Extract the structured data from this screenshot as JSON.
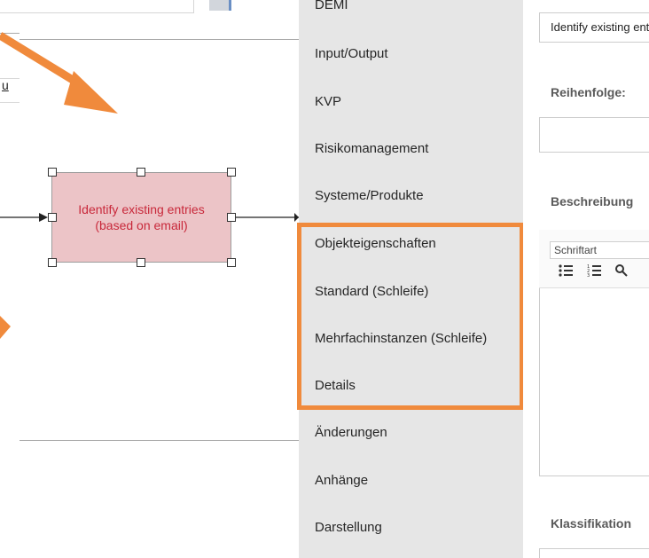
{
  "colors": {
    "accent_orange": "#f08a3c",
    "task_fill": "#ecc4c7",
    "task_text": "#c8283a",
    "menu_bg": "#e6e6e6"
  },
  "canvas": {
    "small_field_text": "u",
    "task": {
      "label_line1": "Identify existing entries",
      "label_line2": "(based on email)"
    }
  },
  "menu": {
    "items": [
      "DEMI",
      "Input/Output",
      "KVP",
      "Risikomanagement",
      "Systeme/Produkte",
      "Objekteigenschaften",
      "Standard (Schleife)",
      "Mehrfachinstanzen (Schleife)",
      "Details",
      "Änderungen",
      "Anhänge",
      "Darstellung"
    ]
  },
  "panel": {
    "name_value": "Identify existing entries",
    "order_label": "Reihenfolge:",
    "order_value": "",
    "description_label": "Beschreibung",
    "font_placeholder": "Schriftart",
    "toolbar_icons": [
      "bulleted-list-icon",
      "numbered-list-icon",
      "link-icon"
    ],
    "classification_label": "Klassifikation"
  }
}
